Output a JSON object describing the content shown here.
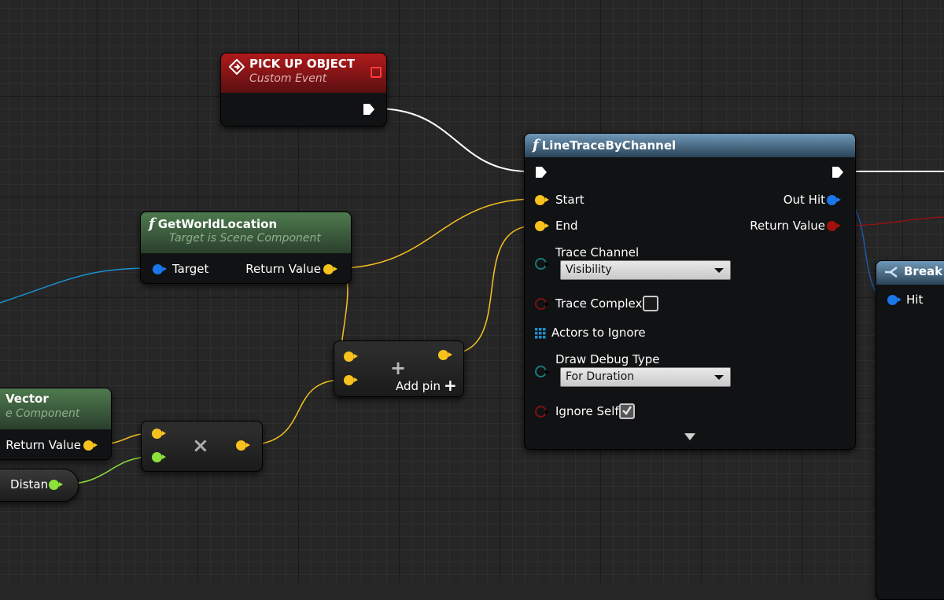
{
  "colors": {
    "exec": "#ffffff",
    "vector": "#f8c21e",
    "object": "#1b76e8",
    "boolean": "#a0100c",
    "float": "#8ce23a",
    "struct": "#1e5aa8"
  },
  "event_node": {
    "title": "PICK UP OBJECT",
    "subtitle": "Custom Event"
  },
  "world_location": {
    "title": "GetWorldLocation",
    "subtitle": "Target is Scene Component",
    "target": "Target",
    "return_value": "Return Value"
  },
  "vector_node": {
    "title": "Vector",
    "subtitle": "e Component",
    "return_value": "Return Value"
  },
  "distance_node": {
    "label": "Distan"
  },
  "multiply_node": {
    "symbol": "×"
  },
  "add_node": {
    "symbol": "+",
    "add_pin": "Add pin"
  },
  "trace_node": {
    "title": "LineTraceByChannel",
    "start": "Start",
    "end": "End",
    "out_hit": "Out Hit",
    "return_value": "Return Value",
    "trace_channel_label": "Trace Channel",
    "trace_channel_value": "Visibility",
    "trace_complex": "Trace Complex",
    "trace_complex_checked": false,
    "actors_to_ignore": "Actors to Ignore",
    "draw_debug_label": "Draw Debug Type",
    "draw_debug_value": "For Duration",
    "ignore_self": "Ignore Self",
    "ignore_self_checked": true
  },
  "break_node": {
    "title": "Break I",
    "hit": "Hit"
  }
}
